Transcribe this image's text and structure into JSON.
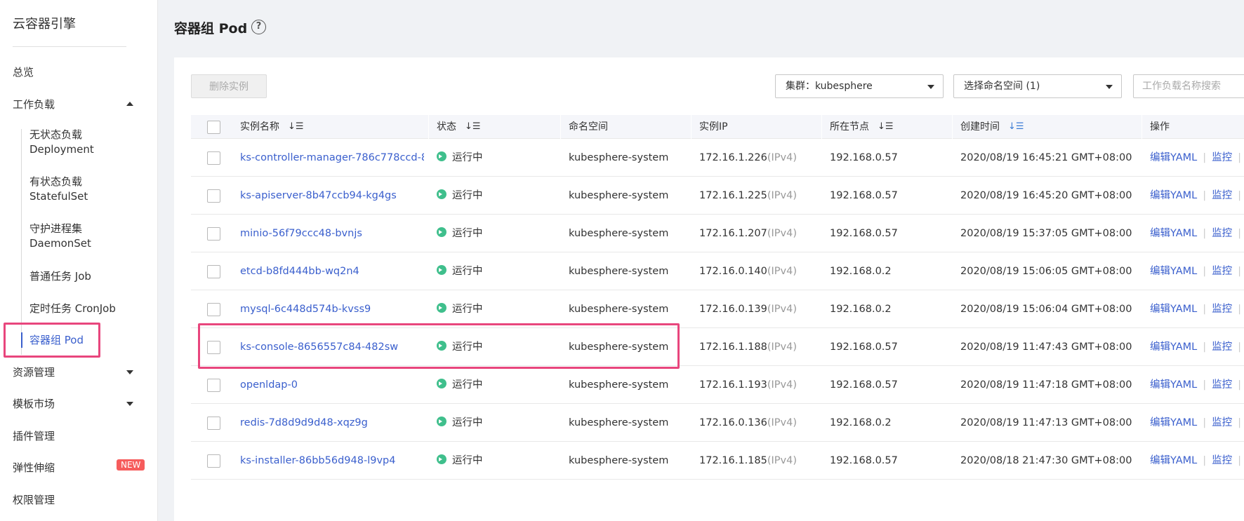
{
  "sidebar": {
    "brand": "云容器引擎",
    "overview": "总览",
    "workload": "工作负载",
    "workload_items": [
      {
        "line1": "无状态负载",
        "line2": "Deployment"
      },
      {
        "line1": "有状态负载",
        "line2": "StatefulSet"
      },
      {
        "line1": "守护进程集",
        "line2": "DaemonSet"
      },
      {
        "line1": "普通任务 Job",
        "line2": ""
      },
      {
        "line1": "定时任务 CronJob",
        "line2": ""
      },
      {
        "line1": "容器组 Pod",
        "line2": ""
      }
    ],
    "resource_mgmt": "资源管理",
    "template_market": "模板市场",
    "plugin_mgmt": "插件管理",
    "autoscaling": "弹性伸缩",
    "new_badge": "NEW",
    "permission_mgmt": "权限管理"
  },
  "header": {
    "title": "容器组 Pod",
    "help_glyph": "?"
  },
  "toolbar": {
    "delete_label": "删除实例",
    "cluster_select": "集群：kubesphere",
    "namespace_select": "选择命名空间 (1)",
    "search_placeholder": "工作负载名称搜索"
  },
  "table": {
    "columns": {
      "name": "实例名称",
      "status": "状态",
      "namespace": "命名空间",
      "ip": "实例IP",
      "node": "所在节点",
      "created": "创建时间",
      "ops": "操作"
    },
    "sort_glyph": "↓☰",
    "ip_type": "(IPv4)",
    "op_edit": "编辑YAML",
    "op_monitor": "监控",
    "op_sep": "|",
    "rows": [
      {
        "name": "ks-controller-manager-786c778ccd-8...",
        "status": "运行中",
        "namespace": "kubesphere-system",
        "ip": "172.16.1.226",
        "node": "192.168.0.57",
        "created": "2020/08/19 16:45:21 GMT+08:00"
      },
      {
        "name": "ks-apiserver-8b47ccb94-kg4gs",
        "status": "运行中",
        "namespace": "kubesphere-system",
        "ip": "172.16.1.225",
        "node": "192.168.0.57",
        "created": "2020/08/19 16:45:20 GMT+08:00"
      },
      {
        "name": "minio-56f79ccc48-bvnjs",
        "status": "运行中",
        "namespace": "kubesphere-system",
        "ip": "172.16.1.207",
        "node": "192.168.0.57",
        "created": "2020/08/19 15:37:05 GMT+08:00"
      },
      {
        "name": "etcd-b8fd444bb-wq2n4",
        "status": "运行中",
        "namespace": "kubesphere-system",
        "ip": "172.16.0.140",
        "node": "192.168.0.2",
        "created": "2020/08/19 15:06:05 GMT+08:00"
      },
      {
        "name": "mysql-6c448d574b-kvss9",
        "status": "运行中",
        "namespace": "kubesphere-system",
        "ip": "172.16.0.139",
        "node": "192.168.0.2",
        "created": "2020/08/19 15:06:04 GMT+08:00"
      },
      {
        "name": "ks-console-8656557c84-482sw",
        "status": "运行中",
        "namespace": "kubesphere-system",
        "ip": "172.16.1.188",
        "node": "192.168.0.57",
        "created": "2020/08/19 11:47:43 GMT+08:00"
      },
      {
        "name": "openldap-0",
        "status": "运行中",
        "namespace": "kubesphere-system",
        "ip": "172.16.1.193",
        "node": "192.168.0.57",
        "created": "2020/08/19 11:47:18 GMT+08:00"
      },
      {
        "name": "redis-7d8d9d9d48-xqz9g",
        "status": "运行中",
        "namespace": "kubesphere-system",
        "ip": "172.16.0.136",
        "node": "192.168.0.2",
        "created": "2020/08/19 11:47:13 GMT+08:00"
      },
      {
        "name": "ks-installer-86bb56d948-l9vp4",
        "status": "运行中",
        "namespace": "kubesphere-system",
        "ip": "172.16.1.185",
        "node": "192.168.0.57",
        "created": "2020/08/18 21:47:30 GMT+08:00"
      }
    ]
  },
  "colors": {
    "accent": "#3a5fcd",
    "highlight": "#e8467d",
    "status_running": "#3fbf8c",
    "new_badge": "#f65c5c"
  }
}
